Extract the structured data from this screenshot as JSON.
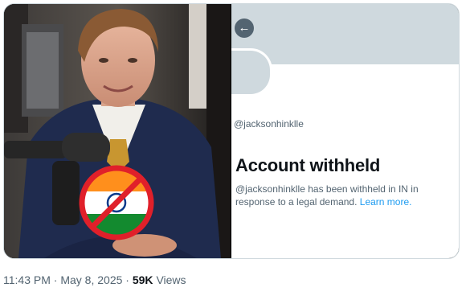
{
  "photo": {
    "flag_icon": "india-flag-prohibited-icon",
    "colors": {
      "saffron": "#ff8f1c",
      "white": "#ffffff",
      "green": "#138a2f",
      "chakra": "#0a3a8a",
      "prohibit_red": "#e0202a"
    }
  },
  "screenshot": {
    "back_icon": "back-arrow-icon",
    "back_glyph": "←",
    "handle": "@jacksonhinklle",
    "headline": "Account withheld",
    "body_text": "@jacksonhinklle has been withheld in IN in response to a legal demand.",
    "learn_more": "Learn more."
  },
  "post_meta": {
    "time": "11:43 PM",
    "separator": "·",
    "date": "May 8, 2025",
    "views_count": "59K",
    "views_label": "Views"
  }
}
